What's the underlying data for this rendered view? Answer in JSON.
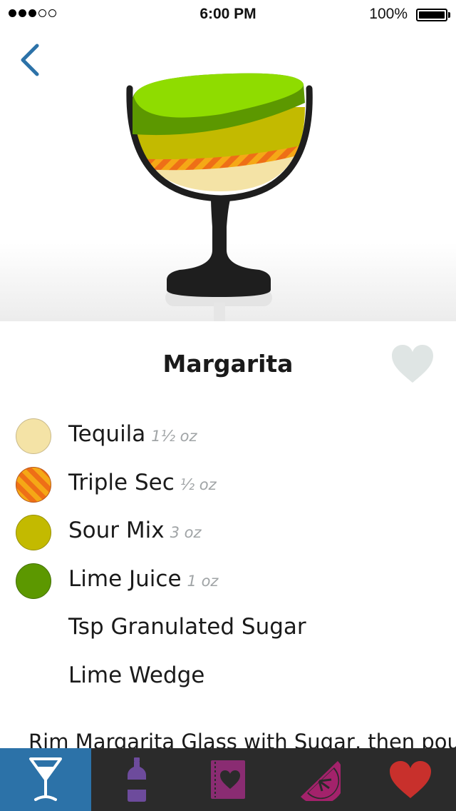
{
  "status_bar": {
    "time": "6:00 PM",
    "battery_text": "100%",
    "signal_bars_filled": 3,
    "signal_bars_total": 5
  },
  "nav": {
    "back_icon": "chevron-left-icon"
  },
  "drink": {
    "name": "Margarita",
    "favorited": false
  },
  "ingredients": [
    {
      "name": "Tequila",
      "amount": "1½ oz",
      "color": "#f4e3a6",
      "pattern": "solid"
    },
    {
      "name": "Triple Sec",
      "amount": "½ oz",
      "color": "#ee6f17",
      "pattern": "striped",
      "stripe_color": "#f5a816"
    },
    {
      "name": "Sour Mix",
      "amount": "3 oz",
      "color": "#c3ba00",
      "pattern": "solid"
    },
    {
      "name": "Lime Juice",
      "amount": "1 oz",
      "color": "#5c9800",
      "pattern": "solid"
    },
    {
      "name": "Tsp Granulated Sugar",
      "amount": "",
      "color": "",
      "pattern": "none"
    },
    {
      "name": "Lime Wedge",
      "amount": "",
      "color": "",
      "pattern": "none"
    }
  ],
  "directions": "Rim Margarita Glass with Sugar, then pour",
  "tabs": [
    {
      "icon": "cocktail-glass-icon",
      "active": true
    },
    {
      "icon": "bottle-icon",
      "active": false
    },
    {
      "icon": "recipe-book-icon",
      "active": false
    },
    {
      "icon": "citrus-slice-icon",
      "active": false
    },
    {
      "icon": "heart-icon",
      "active": false
    }
  ],
  "colors": {
    "accent_blue": "#2c72a8",
    "tab_bar_bg": "#2b2b2b",
    "heart_inactive": "#dfe5e4",
    "bottle_purple": "#6d4b9c",
    "book_magenta": "#8a2c72",
    "citrus_magenta": "#a3226b",
    "heart_red": "#c8302c"
  }
}
